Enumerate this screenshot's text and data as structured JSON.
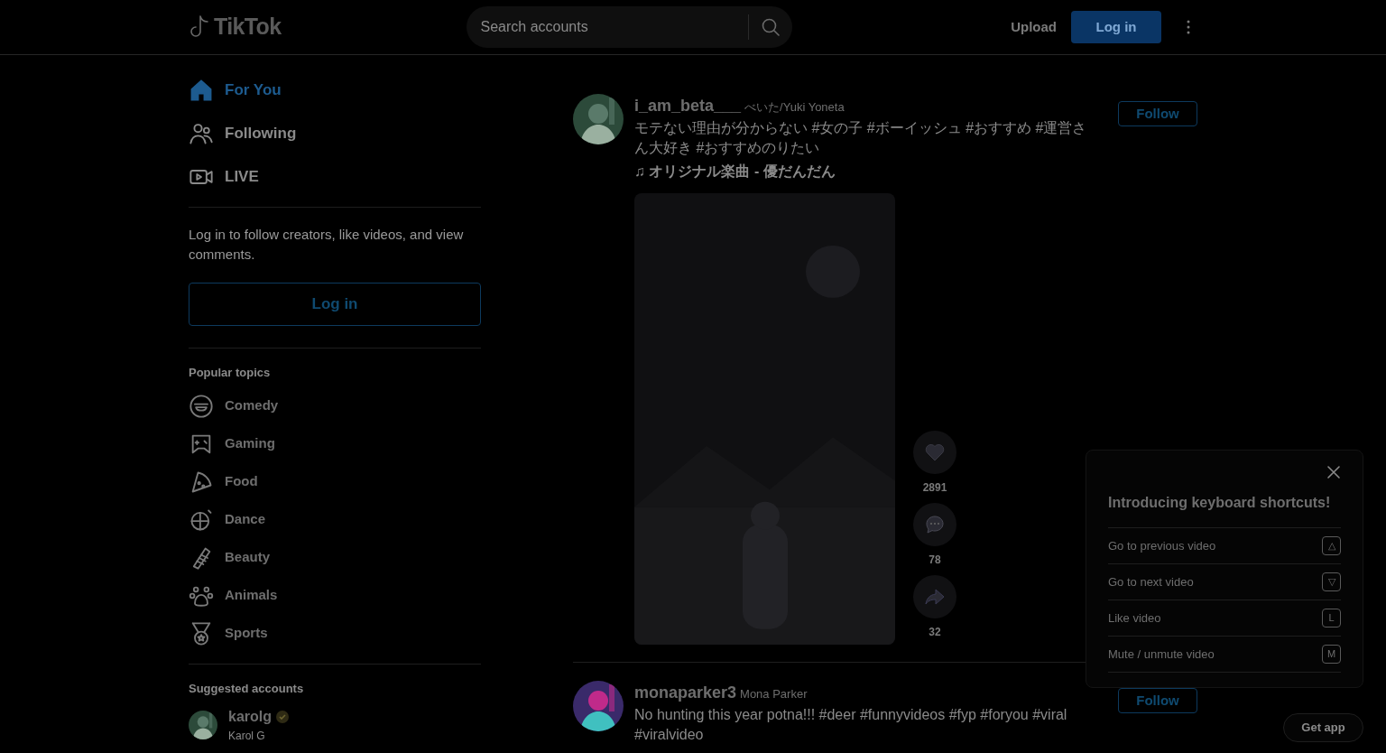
{
  "header": {
    "logo": "TikTok",
    "search": {
      "placeholder": "Search accounts"
    },
    "upload": "Upload",
    "login": "Log in"
  },
  "sidebar": {
    "nav": [
      {
        "label": "For You",
        "selected": true
      },
      {
        "label": "Following",
        "selected": false
      },
      {
        "label": "LIVE",
        "selected": false
      }
    ],
    "login_prompt": "Log in to follow creators, like videos, and view comments.",
    "login_button": "Log in",
    "popular_topics": {
      "title": "Popular topics",
      "items": [
        "Comedy",
        "Gaming",
        "Food",
        "Dance",
        "Beauty",
        "Animals",
        "Sports"
      ]
    },
    "suggested_accounts": {
      "title": "Suggested accounts",
      "accounts": [
        {
          "username": "karolg",
          "name": "Karol G",
          "verified": true
        }
      ]
    }
  },
  "posts": [
    {
      "username": "i_am_beta___",
      "display_name": "べいた/Yuki Yoneta",
      "caption": "モテない理由が分からない #女の子 #ボーイッシュ #おすすめ #運営さん大好き #おすすめのりたい",
      "music": "♫ オリジナル楽曲 - 優だんだん",
      "follow": "Follow",
      "likes": "2891",
      "comments": "78",
      "shares": "32"
    },
    {
      "username": "monaparker3",
      "display_name": "Mona Parker",
      "caption": "No hunting this year potna!!! #deer #funnyvideos #fyp #foryou #viral #viralvideo",
      "follow": "Follow"
    }
  ],
  "shortcuts": {
    "title": "Introducing keyboard shortcuts!",
    "items": [
      {
        "label": "Go to previous video",
        "key": "△"
      },
      {
        "label": "Go to next video",
        "key": "▽"
      },
      {
        "label": "Like video",
        "key": "L"
      },
      {
        "label": "Mute / unmute video",
        "key": "M"
      }
    ]
  },
  "get_app": "Get app"
}
